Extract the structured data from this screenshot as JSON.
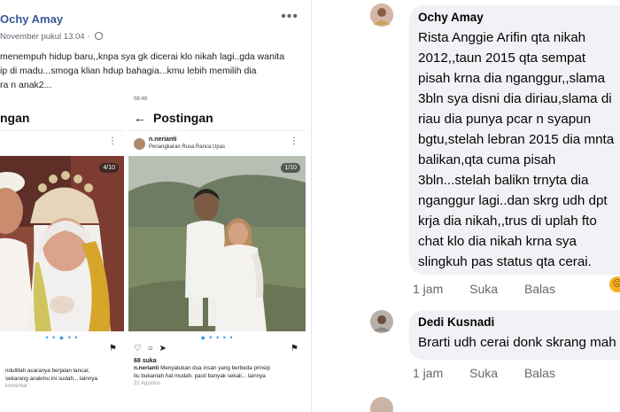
{
  "post": {
    "author": "Ochy Amay",
    "meta": "November pukul 13.04 · ",
    "text_lines": [
      "menempuh hidup baru,,knpa sya gk dicerai klo nikah lagi..gda wanita",
      "ip di madu...smoga klian hdup bahagia...kmu lebih memilih dia",
      "ra n anak2..."
    ]
  },
  "phone_a": {
    "status": "",
    "header": "ngan",
    "counter": "4/10",
    "caption_lines": [
      "ndulillah acaranya berjalan lancar,",
      "sekarang anakmu ini sudah... lainnya"
    ],
    "comments": "komentar"
  },
  "phone_b": {
    "status": "08:49",
    "header": "Postingan",
    "username": "n.nerianti",
    "location": "Penangkaran Rusa Ranca Upas",
    "counter": "1/10",
    "likes": "68 suka",
    "caption_user": "n.nerianti",
    "caption_lines": [
      "Menyatukan dua insan yang berbeda prinsip",
      "itu bukanlah hal mudah. pasti banyak sekali... lainnya"
    ],
    "date": "22 Agustus"
  },
  "comments": [
    {
      "name": "Ochy Amay",
      "text_lines": [
        "Rista Anggie Arifin qta nikah",
        "2012,,taun 2015 qta sempat",
        "pisah krna dia nganggur,,slama",
        "3bln sya disni dia diriau,slama di",
        "riau dia punya pcar n syapun",
        "bgtu,stelah lebran 2015 dia mnta",
        "balikan,qta cuma pisah",
        "3bln...stelah balikn trnyta dia",
        "nganggur lagi..dan skrg udh dpt",
        "krja dia nikah,,trus di uplah fto",
        "chat klo dia nikah krna sya",
        "slingkuh pas status qta cerai."
      ],
      "time": "1 jam",
      "like": "Suka",
      "reply": "Balas"
    },
    {
      "name": "Dedi Kusnadi",
      "text_lines": [
        "Brarti udh cerai donk skrang mah"
      ],
      "time": "1 jam",
      "like": "Suka",
      "reply": "Balas"
    }
  ],
  "icons": {
    "more": "more-dots-icon",
    "back": "back-arrow-icon",
    "globe": "globe-icon",
    "heart": "heart-icon",
    "comment": "comment-icon",
    "share": "share-icon",
    "bookmark": "bookmark-icon",
    "reaction": "sad-reaction-icon"
  },
  "colors": {
    "fb_name": "#385898",
    "bubble": "#f0f2f5",
    "ig_dot": "#3897f0"
  }
}
